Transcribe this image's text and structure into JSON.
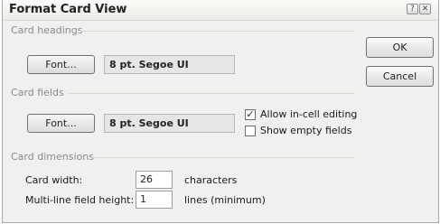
{
  "dialog": {
    "title": "Format Card View",
    "help_glyph": "?",
    "close_glyph": "✕"
  },
  "card_headings": {
    "section_label": "Card headings",
    "font_button": "Font...",
    "font_value": "8 pt. Segoe UI"
  },
  "card_fields": {
    "section_label": "Card fields",
    "font_button": "Font...",
    "font_value": "8 pt. Segoe UI",
    "allow_in_cell_editing": {
      "label": "Allow in-cell editing",
      "checked": true,
      "mark": "✓"
    },
    "show_empty_fields": {
      "label": "Show empty fields",
      "checked": false,
      "mark": ""
    }
  },
  "card_dimensions": {
    "section_label": "Card dimensions",
    "card_width_label": "Card width:",
    "card_width_value": "26",
    "card_width_unit": "characters",
    "multiline_label": "Multi-line field height:",
    "multiline_value": "1",
    "multiline_unit": "lines (minimum)"
  },
  "buttons": {
    "ok": "OK",
    "cancel": "Cancel"
  }
}
